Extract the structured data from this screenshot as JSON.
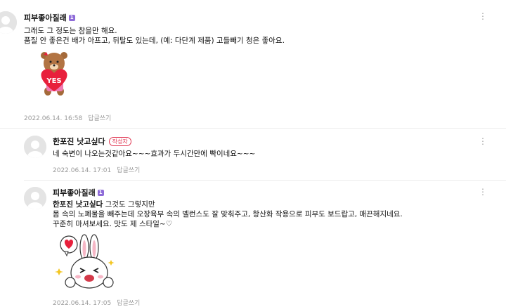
{
  "comments": [
    {
      "nickname": "피부좋아질래",
      "line1": "그래도 그 정도는 참을만 해요.",
      "line2": "품질 안 좋은건 배가 아프고, 뒤탈도 있는데, (예: 다단계 제품) 고들빼기 청은 좋아요.",
      "sticker_text": "YES",
      "date": "2022.06.14. 16:58",
      "reply_label": "답글쓰기"
    },
    {
      "nickname": "한포진 낫고싶다",
      "author_badge": "작성자",
      "line1": "네 숙변이 나오는것같아요~~~효과가 두시간만에 빡이네요~~~",
      "date": "2022.06.14. 17:01",
      "reply_label": "답글쓰기"
    },
    {
      "nickname": "피부좋아질래",
      "mention": "한포진 낫고싶다",
      "line1_rest": " 그것도 그렇지만",
      "line2": "몸 속의 노폐물을 빼주는데 오장육부 속의 벨런스도 잘 맞춰주고, 항산화 작용으로 피부도 보드랍고, 매끈해지네요.",
      "line3": "꾸준히 마셔보세요. 맛도 제 스타일~♡",
      "date": "2022.06.14. 17:05",
      "reply_label": "답글쓰기"
    }
  ],
  "level_badge": "1",
  "more_icon": "⋮",
  "colors": {
    "badge": "#8e6bd8",
    "author": "#e0334f",
    "meta": "#9a9a9a",
    "heart": "#e8203c"
  }
}
